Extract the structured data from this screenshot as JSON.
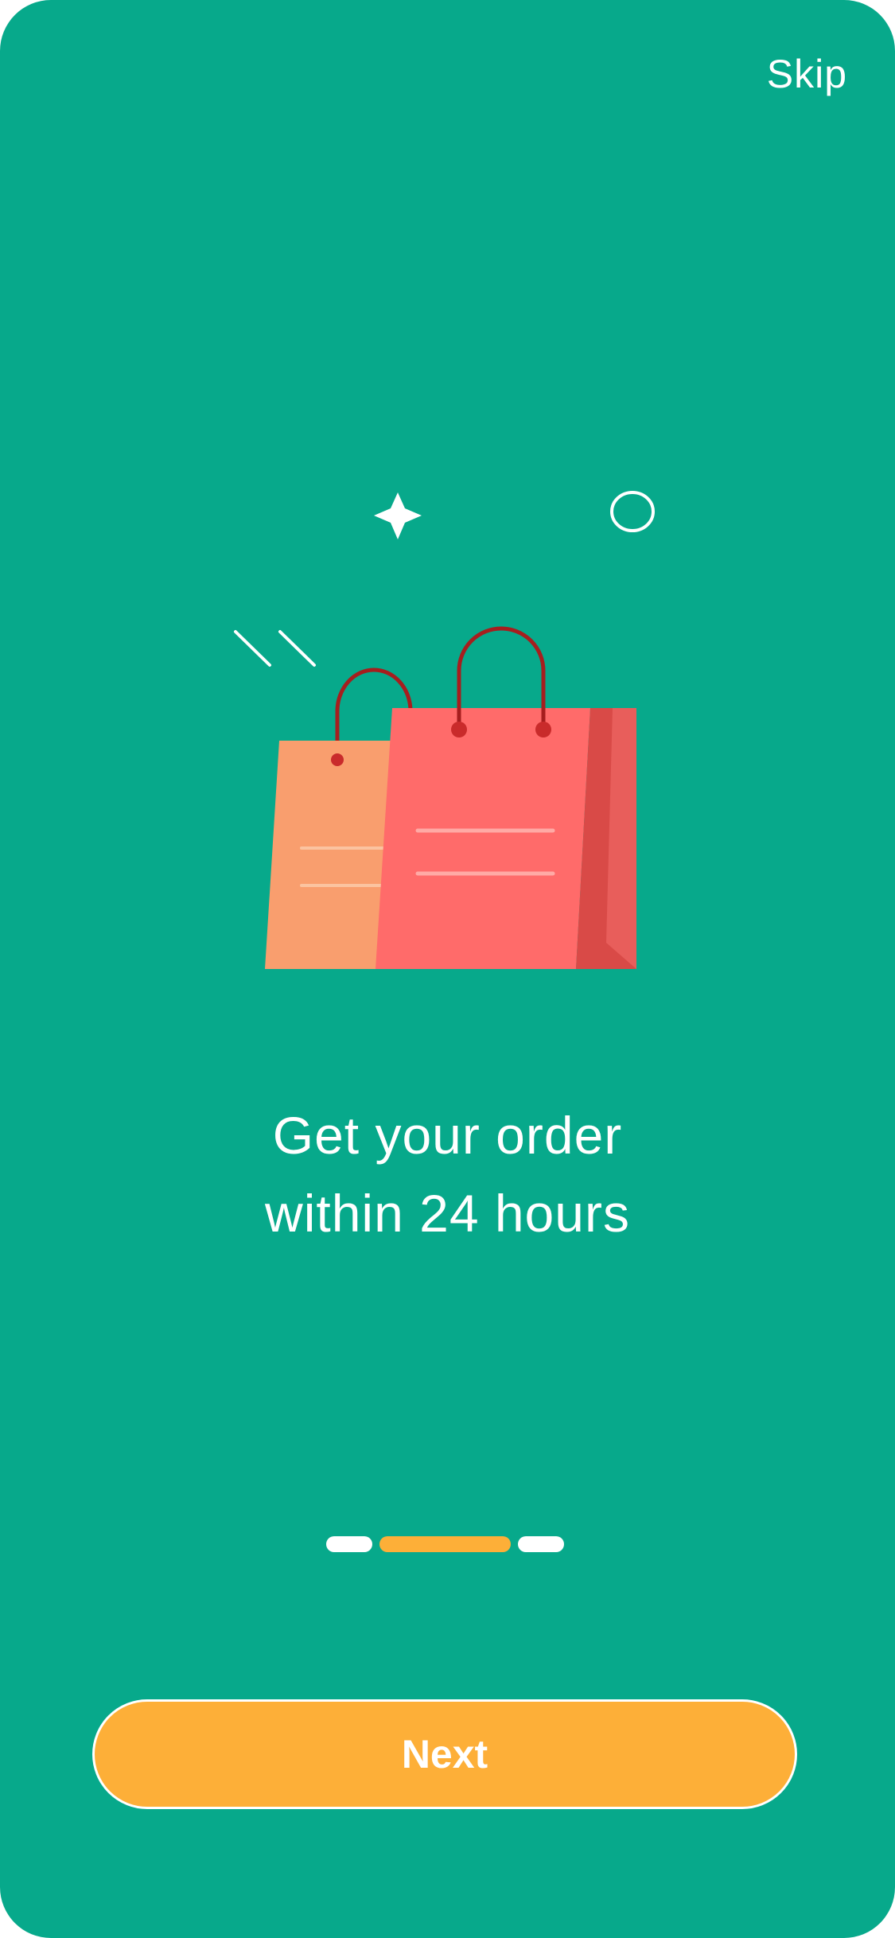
{
  "colors": {
    "background": "#07A98B",
    "accent": "#FDAF38",
    "text": "#FFFFFF",
    "dot_inactive": "#FFFFFF",
    "bag_front": "#FF6B6A",
    "bag_back": "#F99E6E",
    "bag_side": "#D94A47",
    "bag_handle": "#A61E1E"
  },
  "header": {
    "skip_label": "Skip"
  },
  "illustration": {
    "icons": [
      "sparkle-icon",
      "circle-icon",
      "motion-lines-icon",
      "shopping-bags-icon"
    ]
  },
  "main": {
    "headline_line1": "Get your order",
    "headline_line2": "within 24 hours"
  },
  "pagination": {
    "total": 3,
    "active_index": 1
  },
  "footer": {
    "next_label": "Next"
  }
}
